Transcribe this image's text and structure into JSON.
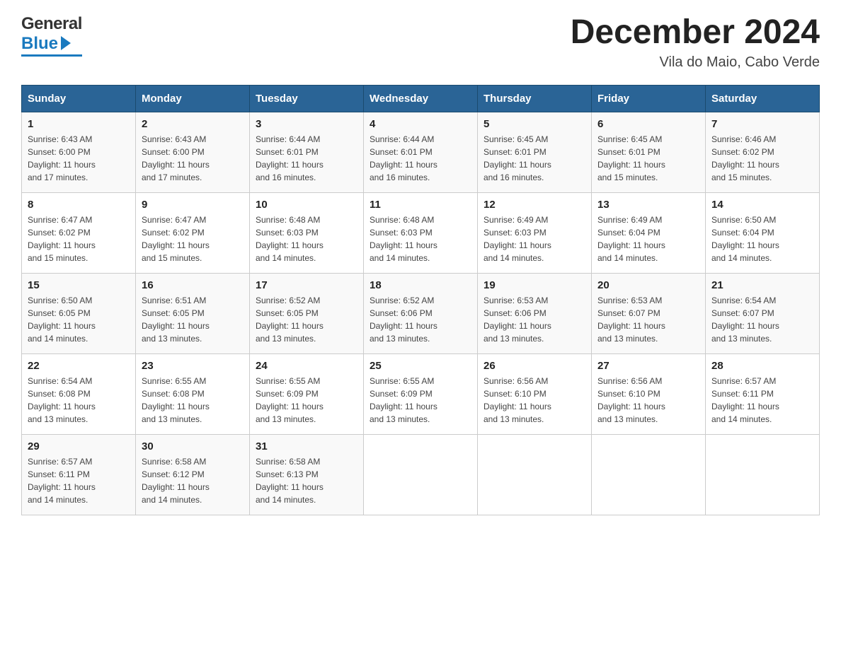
{
  "header": {
    "logo": {
      "general": "General",
      "blue": "Blue",
      "arrow": "▶"
    },
    "title": "December 2024",
    "location": "Vila do Maio, Cabo Verde"
  },
  "days_of_week": [
    "Sunday",
    "Monday",
    "Tuesday",
    "Wednesday",
    "Thursday",
    "Friday",
    "Saturday"
  ],
  "weeks": [
    [
      {
        "day": "1",
        "info": "Sunrise: 6:43 AM\nSunset: 6:00 PM\nDaylight: 11 hours\nand 17 minutes."
      },
      {
        "day": "2",
        "info": "Sunrise: 6:43 AM\nSunset: 6:00 PM\nDaylight: 11 hours\nand 17 minutes."
      },
      {
        "day": "3",
        "info": "Sunrise: 6:44 AM\nSunset: 6:01 PM\nDaylight: 11 hours\nand 16 minutes."
      },
      {
        "day": "4",
        "info": "Sunrise: 6:44 AM\nSunset: 6:01 PM\nDaylight: 11 hours\nand 16 minutes."
      },
      {
        "day": "5",
        "info": "Sunrise: 6:45 AM\nSunset: 6:01 PM\nDaylight: 11 hours\nand 16 minutes."
      },
      {
        "day": "6",
        "info": "Sunrise: 6:45 AM\nSunset: 6:01 PM\nDaylight: 11 hours\nand 15 minutes."
      },
      {
        "day": "7",
        "info": "Sunrise: 6:46 AM\nSunset: 6:02 PM\nDaylight: 11 hours\nand 15 minutes."
      }
    ],
    [
      {
        "day": "8",
        "info": "Sunrise: 6:47 AM\nSunset: 6:02 PM\nDaylight: 11 hours\nand 15 minutes."
      },
      {
        "day": "9",
        "info": "Sunrise: 6:47 AM\nSunset: 6:02 PM\nDaylight: 11 hours\nand 15 minutes."
      },
      {
        "day": "10",
        "info": "Sunrise: 6:48 AM\nSunset: 6:03 PM\nDaylight: 11 hours\nand 14 minutes."
      },
      {
        "day": "11",
        "info": "Sunrise: 6:48 AM\nSunset: 6:03 PM\nDaylight: 11 hours\nand 14 minutes."
      },
      {
        "day": "12",
        "info": "Sunrise: 6:49 AM\nSunset: 6:03 PM\nDaylight: 11 hours\nand 14 minutes."
      },
      {
        "day": "13",
        "info": "Sunrise: 6:49 AM\nSunset: 6:04 PM\nDaylight: 11 hours\nand 14 minutes."
      },
      {
        "day": "14",
        "info": "Sunrise: 6:50 AM\nSunset: 6:04 PM\nDaylight: 11 hours\nand 14 minutes."
      }
    ],
    [
      {
        "day": "15",
        "info": "Sunrise: 6:50 AM\nSunset: 6:05 PM\nDaylight: 11 hours\nand 14 minutes."
      },
      {
        "day": "16",
        "info": "Sunrise: 6:51 AM\nSunset: 6:05 PM\nDaylight: 11 hours\nand 13 minutes."
      },
      {
        "day": "17",
        "info": "Sunrise: 6:52 AM\nSunset: 6:05 PM\nDaylight: 11 hours\nand 13 minutes."
      },
      {
        "day": "18",
        "info": "Sunrise: 6:52 AM\nSunset: 6:06 PM\nDaylight: 11 hours\nand 13 minutes."
      },
      {
        "day": "19",
        "info": "Sunrise: 6:53 AM\nSunset: 6:06 PM\nDaylight: 11 hours\nand 13 minutes."
      },
      {
        "day": "20",
        "info": "Sunrise: 6:53 AM\nSunset: 6:07 PM\nDaylight: 11 hours\nand 13 minutes."
      },
      {
        "day": "21",
        "info": "Sunrise: 6:54 AM\nSunset: 6:07 PM\nDaylight: 11 hours\nand 13 minutes."
      }
    ],
    [
      {
        "day": "22",
        "info": "Sunrise: 6:54 AM\nSunset: 6:08 PM\nDaylight: 11 hours\nand 13 minutes."
      },
      {
        "day": "23",
        "info": "Sunrise: 6:55 AM\nSunset: 6:08 PM\nDaylight: 11 hours\nand 13 minutes."
      },
      {
        "day": "24",
        "info": "Sunrise: 6:55 AM\nSunset: 6:09 PM\nDaylight: 11 hours\nand 13 minutes."
      },
      {
        "day": "25",
        "info": "Sunrise: 6:55 AM\nSunset: 6:09 PM\nDaylight: 11 hours\nand 13 minutes."
      },
      {
        "day": "26",
        "info": "Sunrise: 6:56 AM\nSunset: 6:10 PM\nDaylight: 11 hours\nand 13 minutes."
      },
      {
        "day": "27",
        "info": "Sunrise: 6:56 AM\nSunset: 6:10 PM\nDaylight: 11 hours\nand 13 minutes."
      },
      {
        "day": "28",
        "info": "Sunrise: 6:57 AM\nSunset: 6:11 PM\nDaylight: 11 hours\nand 14 minutes."
      }
    ],
    [
      {
        "day": "29",
        "info": "Sunrise: 6:57 AM\nSunset: 6:11 PM\nDaylight: 11 hours\nand 14 minutes."
      },
      {
        "day": "30",
        "info": "Sunrise: 6:58 AM\nSunset: 6:12 PM\nDaylight: 11 hours\nand 14 minutes."
      },
      {
        "day": "31",
        "info": "Sunrise: 6:58 AM\nSunset: 6:13 PM\nDaylight: 11 hours\nand 14 minutes."
      },
      {
        "day": "",
        "info": ""
      },
      {
        "day": "",
        "info": ""
      },
      {
        "day": "",
        "info": ""
      },
      {
        "day": "",
        "info": ""
      }
    ]
  ]
}
